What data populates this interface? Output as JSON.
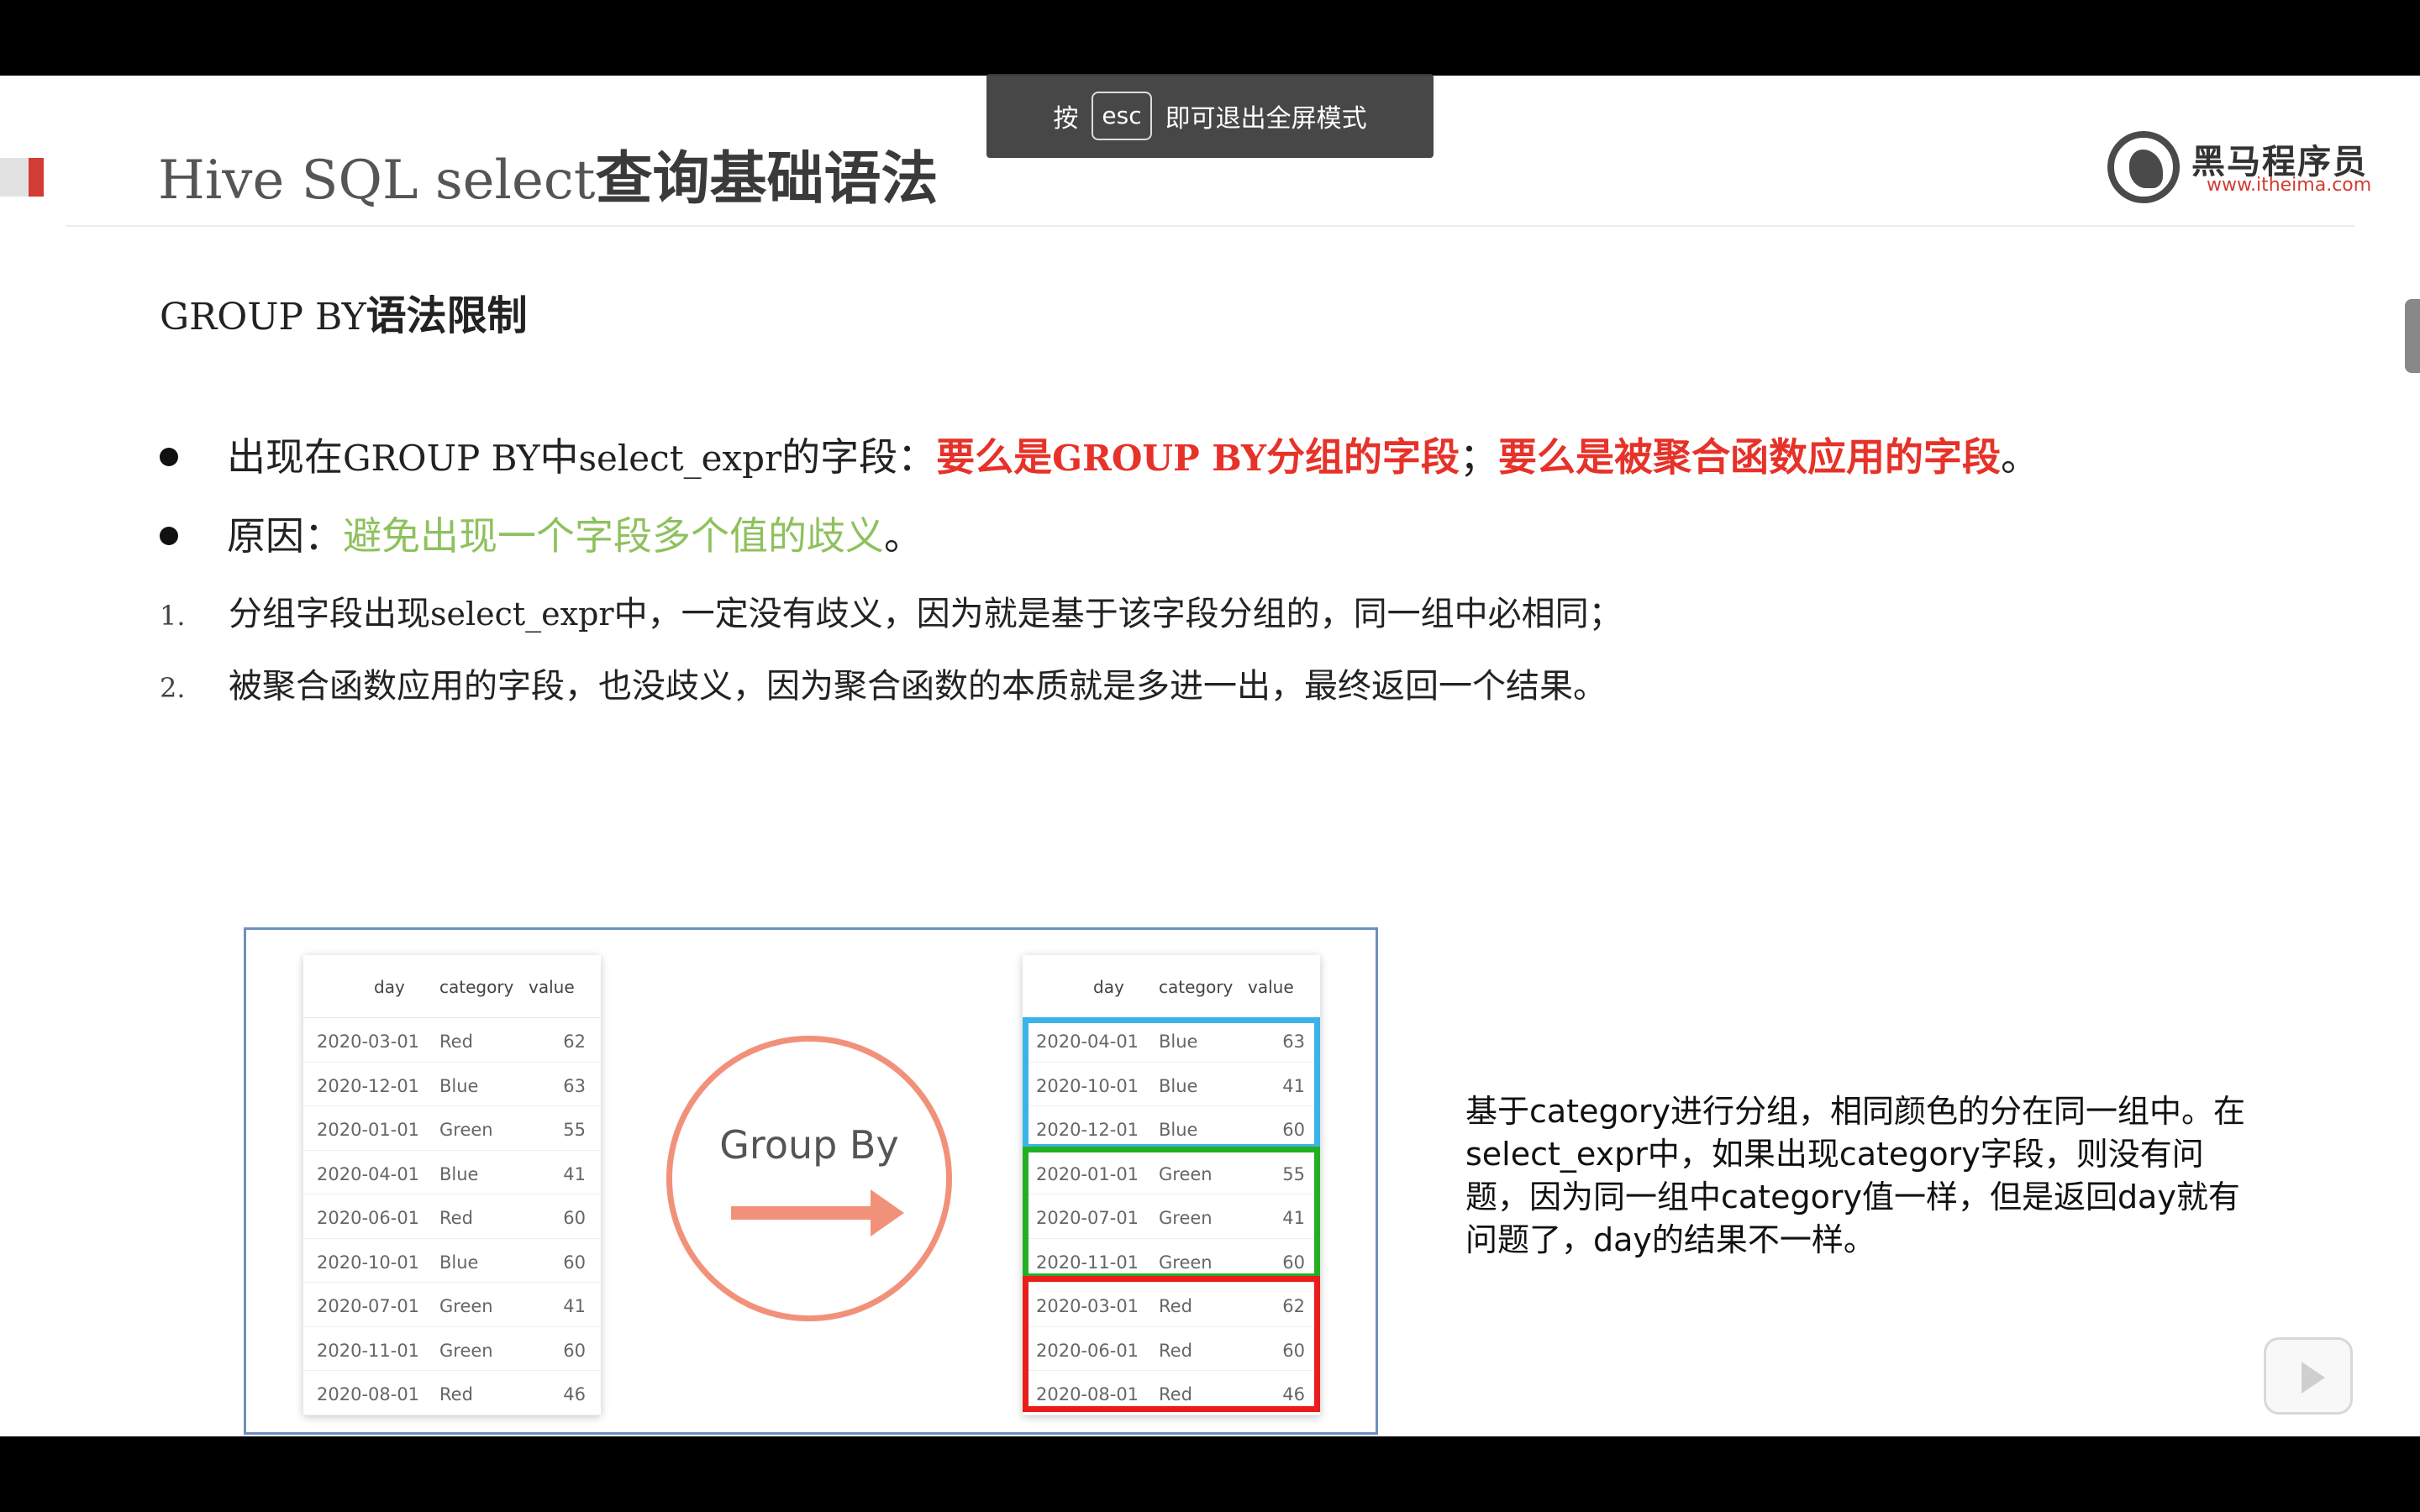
{
  "slide": {
    "title_code": "Hive SQL select",
    "title_cn": "查询基础语法",
    "logo": {
      "name": "黑马程序员",
      "url": "www.itheima.com"
    },
    "subtitle_code": "GROUP BY",
    "subtitle_cn": "语法限制",
    "bullet1": {
      "p1": "出现在",
      "p2": "GROUP BY",
      "p3": "中",
      "p4": "select_expr",
      "p5": "的字段：",
      "p6": "要么是",
      "p7": "GROUP BY",
      "p8": "分组的字段",
      "p9": "；",
      "p10": "要么是被聚合函数应用的字段",
      "p11": "。"
    },
    "bullet2": {
      "p1": "原因：",
      "p2": "避免出现一个字段多个值的歧义",
      "p3": "。"
    },
    "item1": {
      "num": "1.",
      "p1": "分组字段出现",
      "p2": "select_expr",
      "p3": "中，一定没有歧义，因为就是基于该字段分组的，同一组中必相同；"
    },
    "item2": {
      "num": "2.",
      "p1": "被聚合函数应用的字段，也没歧义，因为聚合函数的本质就是多进一出，最终返回一个结果。"
    },
    "figure": {
      "headers": [
        "day",
        "category",
        "value"
      ],
      "left_rows": [
        [
          "2020-03-01",
          "Red",
          "62"
        ],
        [
          "2020-12-01",
          "Blue",
          "63"
        ],
        [
          "2020-01-01",
          "Green",
          "55"
        ],
        [
          "2020-04-01",
          "Blue",
          "41"
        ],
        [
          "2020-06-01",
          "Red",
          "60"
        ],
        [
          "2020-10-01",
          "Blue",
          "60"
        ],
        [
          "2020-07-01",
          "Green",
          "41"
        ],
        [
          "2020-11-01",
          "Green",
          "60"
        ],
        [
          "2020-08-01",
          "Red",
          "46"
        ]
      ],
      "group_by_label": "Group By",
      "right_rows": [
        [
          "2020-04-01",
          "Blue",
          "63"
        ],
        [
          "2020-10-01",
          "Blue",
          "41"
        ],
        [
          "2020-12-01",
          "Blue",
          "60"
        ],
        [
          "2020-01-01",
          "Green",
          "55"
        ],
        [
          "2020-07-01",
          "Green",
          "41"
        ],
        [
          "2020-11-01",
          "Green",
          "60"
        ],
        [
          "2020-03-01",
          "Red",
          "62"
        ],
        [
          "2020-06-01",
          "Red",
          "60"
        ],
        [
          "2020-08-01",
          "Red",
          "46"
        ]
      ],
      "group_colors": {
        "blue": "#3ab4e8",
        "green": "#22b022",
        "red": "#ea1c1c"
      }
    },
    "side_note": "基于category进行分组，相同颜色的分在同一组中。在select_expr中，如果出现category字段，则没有问题，因为同一组中category值一样，但是返回day就有问题了，day的结果不一样。"
  },
  "fullscreen_toast": {
    "prefix": "按",
    "key": "esc",
    "suffix": "即可退出全屏模式"
  },
  "controls": {
    "play_icon": "play-icon"
  },
  "colors": {
    "accent_red": "#e63229",
    "accent_green": "#8ec15e",
    "bar_red": "#c94237"
  }
}
